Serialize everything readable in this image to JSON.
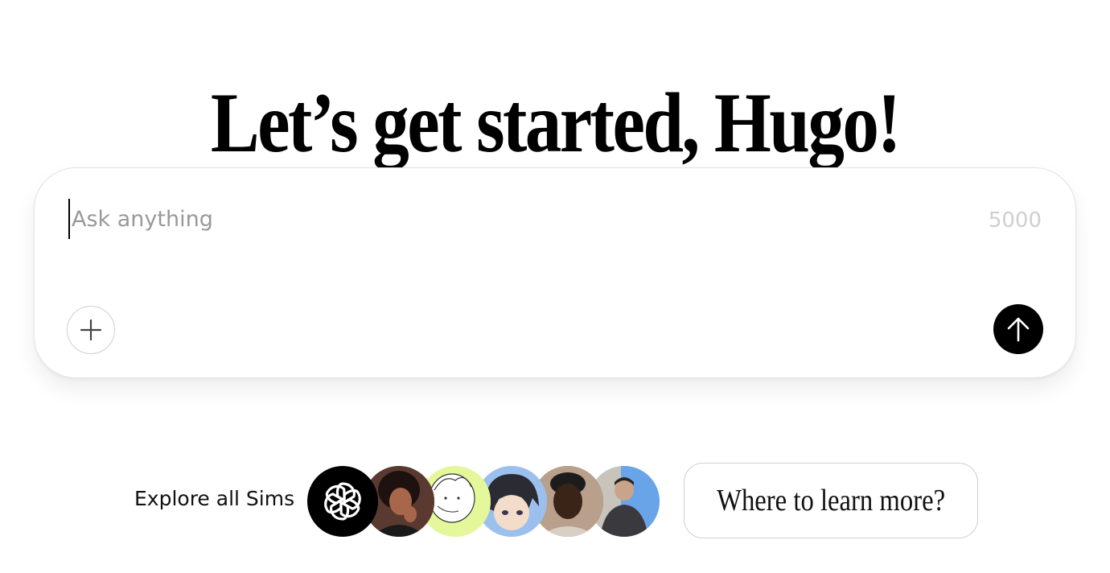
{
  "heading": "Let’s get started, Hugo!",
  "composer": {
    "placeholder": "Ask anything",
    "value": "",
    "char_limit": "5000",
    "attach_icon": "plus-icon",
    "send_icon": "arrow-up-icon"
  },
  "explore": {
    "label": "Explore all Sims",
    "avatars": [
      {
        "name": "openai-logo-avatar",
        "bg": "#000000"
      },
      {
        "name": "woman-portrait-avatar",
        "bg": "#4a2a22"
      },
      {
        "name": "sketch-character-avatar",
        "bg": "#e4f79a"
      },
      {
        "name": "anime-character-avatar",
        "bg": "#8fb4e6"
      },
      {
        "name": "man-portrait-avatar",
        "bg": "#7a5a44"
      },
      {
        "name": "man-outdoor-portrait-avatar",
        "bg": "#6aa4e8"
      }
    ],
    "suggestion": "Where to learn more?"
  },
  "colors": {
    "send_button": "#000000",
    "border": "#e3e3e3",
    "placeholder": "#999999",
    "counter": "#cfcfcf"
  }
}
